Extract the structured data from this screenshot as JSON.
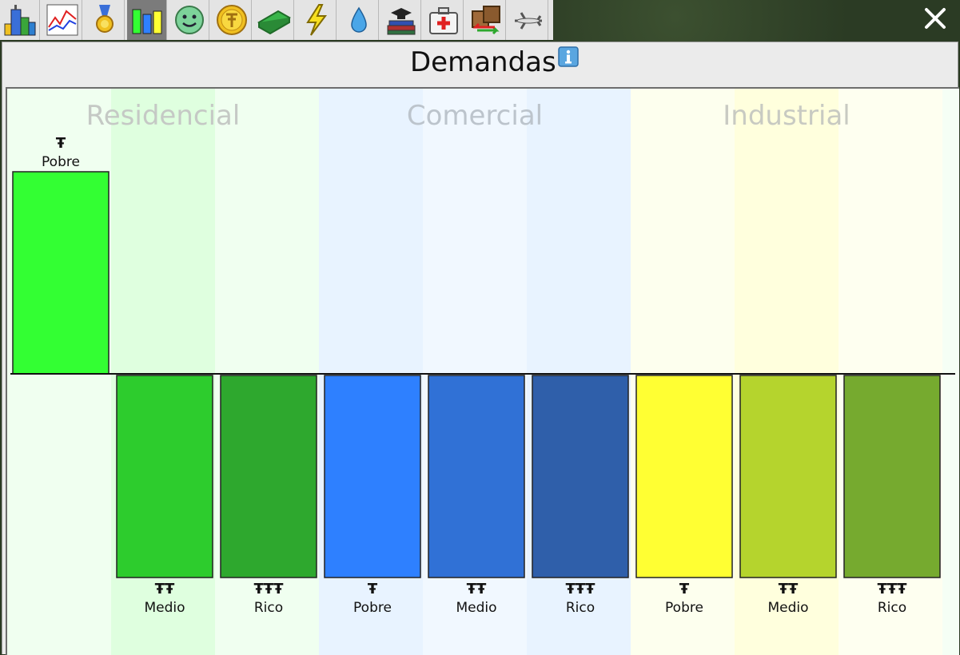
{
  "toolbar": {
    "buttons": [
      {
        "id": "city",
        "icon": "city-buildings-icon"
      },
      {
        "id": "graphs",
        "icon": "line-graph-icon"
      },
      {
        "id": "awards",
        "icon": "medal-icon"
      },
      {
        "id": "demand",
        "icon": "demand-bars-icon",
        "active": true
      },
      {
        "id": "happiness",
        "icon": "smiley-face-icon"
      },
      {
        "id": "taxes",
        "icon": "gold-coin-icon"
      },
      {
        "id": "budget",
        "icon": "money-stack-icon"
      },
      {
        "id": "power",
        "icon": "lightning-icon"
      },
      {
        "id": "water",
        "icon": "water-drop-icon"
      },
      {
        "id": "education",
        "icon": "books-graduation-cap-icon"
      },
      {
        "id": "health",
        "icon": "medical-kit-icon"
      },
      {
        "id": "trade",
        "icon": "trade-crates-icon"
      },
      {
        "id": "transport",
        "icon": "airplane-icon"
      }
    ]
  },
  "panel": {
    "title": "Demandas"
  },
  "chart_data": {
    "type": "bar",
    "groups": [
      {
        "name": "Residencial",
        "color": "#c5c9c5"
      },
      {
        "name": "Comercial",
        "color": "#bcc4cc"
      },
      {
        "name": "Industrial",
        "color": "#c8cac2"
      }
    ],
    "categories": [
      {
        "group": "Residencial",
        "label": "Pobre",
        "symbol": "Ŧ",
        "value": 1.0,
        "color": "#33ff33",
        "band": "#f0fff0"
      },
      {
        "group": "Residencial",
        "label": "Medio",
        "symbol": "ŦŦ",
        "value": -1.0,
        "color": "#2dcc2d",
        "band": "#dfffdf"
      },
      {
        "group": "Residencial",
        "label": "Rico",
        "symbol": "ŦŦŦ",
        "value": -1.0,
        "color": "#2ea82e",
        "band": "#f0fff0"
      },
      {
        "group": "Comercial",
        "label": "Pobre",
        "symbol": "Ŧ",
        "value": -1.0,
        "color": "#2e80ff",
        "band": "#e8f3ff"
      },
      {
        "group": "Comercial",
        "label": "Medio",
        "symbol": "ŦŦ",
        "value": -1.0,
        "color": "#3071d6",
        "band": "#f1f8ff"
      },
      {
        "group": "Comercial",
        "label": "Rico",
        "symbol": "ŦŦŦ",
        "value": -1.0,
        "color": "#2f5faa",
        "band": "#e8f3ff"
      },
      {
        "group": "Industrial",
        "label": "Pobre",
        "symbol": "Ŧ",
        "value": -1.0,
        "color": "#ffff33",
        "band": "#fdffee"
      },
      {
        "group": "Industrial",
        "label": "Medio",
        "symbol": "ŦŦ",
        "value": -1.0,
        "color": "#b5d42d",
        "band": "#ffffdd"
      },
      {
        "group": "Industrial",
        "label": "Rico",
        "symbol": "ŦŦŦ",
        "value": -1.0,
        "color": "#76aa2f",
        "band": "#fefff0"
      }
    ],
    "ylim": [
      -1,
      1
    ],
    "grid": false
  }
}
